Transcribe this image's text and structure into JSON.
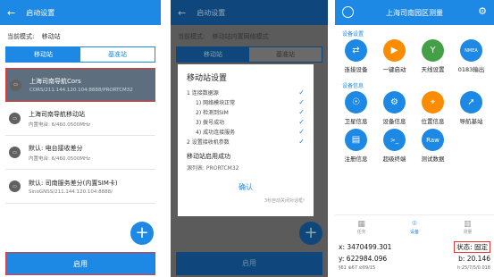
{
  "left": {
    "title": "启动设置",
    "mode_label": "当前模式:",
    "mode_value": "移动站",
    "tabs": [
      "移动站",
      "基准站"
    ],
    "items": [
      {
        "icon": "network-icon",
        "name": "上海司南导航Cors",
        "detail": "CORS/211.144.120.104:8888/PRORTCM32"
      },
      {
        "icon": "radio-icon",
        "name": "上海司南导航移动站",
        "detail": "内置电台: 6/460.0500MHz"
      },
      {
        "icon": "radio-icon",
        "name": "默认: 电台接收差分",
        "detail": "内置电台: 6/460.0500MHz"
      },
      {
        "icon": "network-icon",
        "name": "默认: 司南服务差分(内置SIM卡)",
        "detail": "SinoGNSS/211.144.120.104:8888/"
      }
    ],
    "start_button": "启用"
  },
  "middle": {
    "title": "启动设置",
    "mode_label": "当前模式:",
    "mode_value": "移动站内置网络模式",
    "tabs": [
      "移动站",
      "基准站"
    ],
    "dialog": {
      "title": "移动站设置",
      "steps": [
        {
          "text": "1 连接数据源",
          "sub": false
        },
        {
          "text": "1) 网络模块正常",
          "sub": true
        },
        {
          "text": "2) 检测到SIM",
          "sub": true
        },
        {
          "text": "3) 拨号成功",
          "sub": true
        },
        {
          "text": "4) 成功连接服务",
          "sub": true
        },
        {
          "text": "2 设置接收机参数",
          "sub": false
        }
      ],
      "success": "移动站启用成功",
      "source": "源列表: PRORTCM32",
      "ok": "确认",
      "auto_close": "3秒自动关闭对话框!"
    },
    "start_button": "启用"
  },
  "right": {
    "title": "上海司南园区测量",
    "section_device": "设备设置",
    "section_info": "设备信息",
    "tiles": [
      {
        "icon": "connect-device-icon",
        "label": "连接设备",
        "color": "#1e88e5",
        "glyph": "⇄"
      },
      {
        "icon": "one-key-start-icon",
        "label": "一键启动",
        "color": "#fb8c00",
        "glyph": "▶"
      },
      {
        "icon": "antenna-icon",
        "label": "天线设置",
        "color": "#43a047",
        "glyph": "Y"
      },
      {
        "icon": "nmea-output-icon",
        "label": "0183输出",
        "color": "#1e88e5",
        "glyph": "N"
      },
      {
        "icon": "satellite-icon",
        "label": "卫星信息",
        "color": "#1e88e5",
        "glyph": "☉"
      },
      {
        "icon": "device-info-icon",
        "label": "设备信息",
        "color": "#1e88e5",
        "glyph": "⚙"
      },
      {
        "icon": "position-icon",
        "label": "位置信息",
        "color": "#fb8c00",
        "glyph": "⌖"
      },
      {
        "icon": "navigation-base-icon",
        "label": "导航基站",
        "color": "#1e88e5",
        "glyph": "➚"
      },
      {
        "icon": "register-device-icon",
        "label": "注册信息",
        "color": "#1e88e5",
        "glyph": "▤"
      },
      {
        "icon": "super-terminal-icon",
        "label": "超级终端",
        "color": "#1e88e5",
        "glyph": ">_"
      },
      {
        "icon": "raw-data-icon",
        "label": "测试数据",
        "color": "#1e88e5",
        "glyph": "Raw"
      }
    ],
    "nav": [
      {
        "icon": "task-icon",
        "label": "任务"
      },
      {
        "icon": "device-icon",
        "label": "设备"
      },
      {
        "icon": "survey-icon",
        "label": "测量"
      }
    ],
    "x_value": "x: 3470499.301",
    "y_value": "y: 622984.096",
    "state": "状态: 固定",
    "b_value": "b: 20.146",
    "status_bar": "§61  ⊕67  ⊘09/15",
    "time": "h:25/7/5/0.018"
  }
}
